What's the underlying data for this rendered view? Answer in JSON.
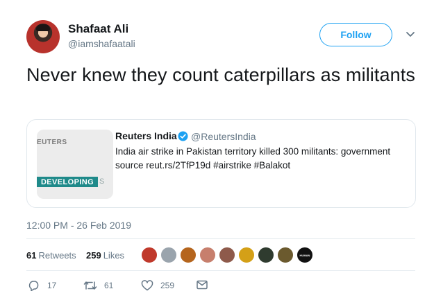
{
  "author": {
    "name": "Shafaat Ali",
    "handle": "@iamshafaatali"
  },
  "follow_button": {
    "label": "Follow"
  },
  "tweet": {
    "text": "Never knew they count caterpillars as militants",
    "timestamp": "12:00 PM - 26 Feb 2019"
  },
  "quoted": {
    "source_name": "Reuters India",
    "source_handle": "@ReutersIndia",
    "body": "India air strike in Pakistan territory killed 300 militants: government source reut.rs/2TfP19d #airstrike #Balakot",
    "thumbnail": {
      "brand_text": "EUTERS",
      "band_text": "DEVELOPING",
      "band_tail": "S"
    }
  },
  "stats": {
    "retweets_count": "61",
    "retweets_label": "Retweets",
    "likes_count": "259",
    "likes_label": "Likes"
  },
  "liker_avatars": [
    {
      "color": "#c0392b"
    },
    {
      "color": "#9aa4ad"
    },
    {
      "color": "#b5651d"
    },
    {
      "color": "#c77f6d"
    },
    {
      "color": "#8e5a4b"
    },
    {
      "color": "#d4a017"
    },
    {
      "color": "#2f3b2f"
    },
    {
      "color": "#6b5a2e"
    },
    {
      "color": "#111111",
      "text": "HUMAN"
    }
  ],
  "actions": {
    "reply_count": "17",
    "retweet_count": "61",
    "like_count": "259"
  },
  "colors": {
    "accent": "#1da1f2",
    "muted": "#657786",
    "text": "#14171a",
    "retweet_icon": "#657786"
  }
}
